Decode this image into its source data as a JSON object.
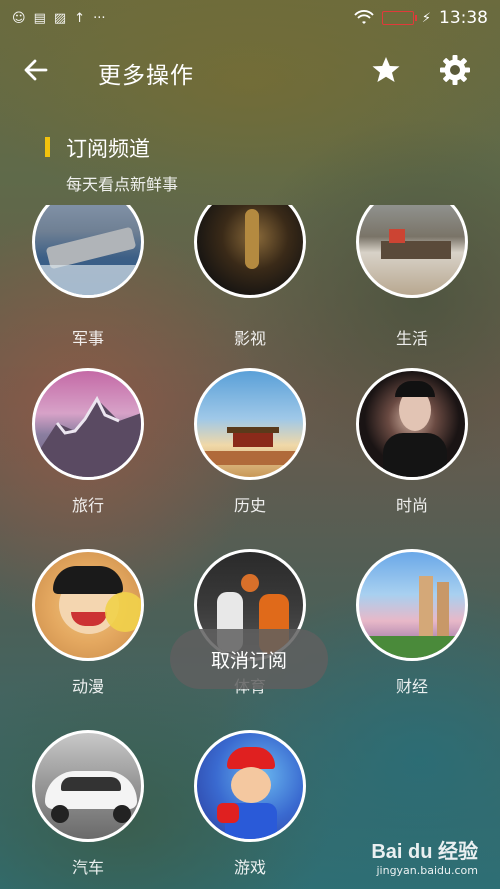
{
  "status_bar": {
    "time": "13:38",
    "left_icons": [
      "face-icon",
      "message-icon",
      "image-icon",
      "upload-icon",
      "more-icon"
    ]
  },
  "header": {
    "title": "更多操作",
    "back_icon": "back-arrow-icon",
    "star_icon": "star-icon",
    "gear_icon": "gear-icon"
  },
  "section": {
    "title": "订阅频道",
    "subtitle": "每天看点新鲜事",
    "accent_color": "#f2c20d"
  },
  "channels": [
    {
      "label": "军事"
    },
    {
      "label": "影视"
    },
    {
      "label": "生活"
    },
    {
      "label": "旅行"
    },
    {
      "label": "历史"
    },
    {
      "label": "时尚"
    },
    {
      "label": "动漫"
    },
    {
      "label": "体育"
    },
    {
      "label": "财经"
    },
    {
      "label": "汽车"
    },
    {
      "label": "游戏"
    }
  ],
  "toast": {
    "text": "取消订阅"
  },
  "watermark": {
    "logo": "Bai du 经验",
    "url": "jingyan.baidu.com"
  }
}
